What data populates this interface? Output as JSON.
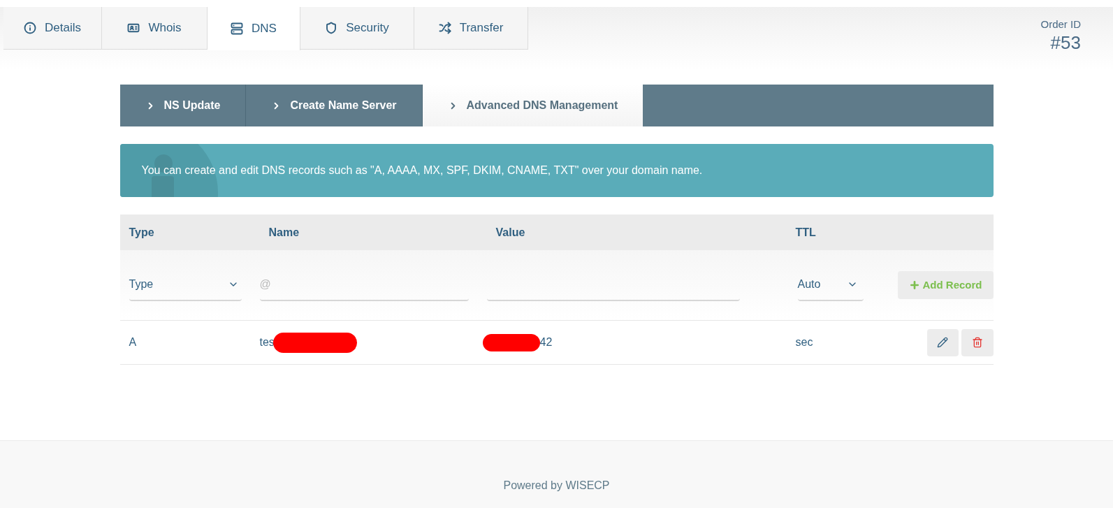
{
  "tabs": [
    {
      "label": "Details",
      "kind": "info",
      "selected": false
    },
    {
      "label": "Whois",
      "kind": "card",
      "selected": false
    },
    {
      "label": "DNS",
      "kind": "server",
      "selected": true
    },
    {
      "label": "Security",
      "kind": "shield",
      "selected": false
    },
    {
      "label": "Transfer",
      "kind": "shuffle",
      "selected": false
    }
  ],
  "order": {
    "label": "Order ID",
    "value": "#53"
  },
  "subtabs": [
    {
      "label": "NS Update",
      "selected": false
    },
    {
      "label": "Create Name Server",
      "selected": false
    },
    {
      "label": "Advanced DNS Management",
      "selected": true
    }
  ],
  "alert": "You can create and edit DNS records such as \"A, AAAA, MX, SPF, DKIM, CNAME, TXT\" over your domain name.",
  "table": {
    "columns": [
      "Type",
      "Name",
      "Value",
      "TTL"
    ],
    "form": {
      "type": "Type",
      "name_placeholder": "@",
      "ttl": "Auto",
      "button": "Add Record"
    },
    "rows": [
      {
        "type": "A",
        "name": "tes",
        "value": "42",
        "ttl": "sec"
      }
    ]
  },
  "footer": "Powered by WISECP"
}
